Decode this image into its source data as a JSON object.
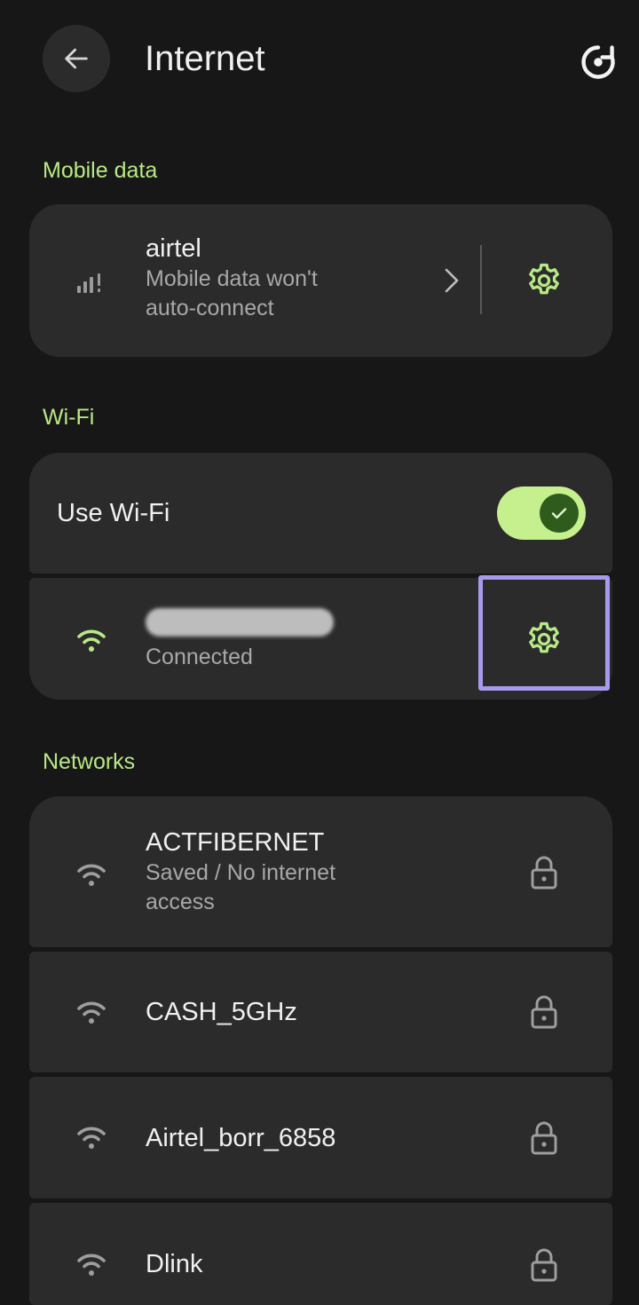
{
  "header": {
    "title": "Internet",
    "back_icon": "arrow-back-icon",
    "reset_icon": "network-reset-icon"
  },
  "mobile_data": {
    "section_label": "Mobile data",
    "carrier": "airtel",
    "status_line1": "Mobile data won't",
    "status_line2": "auto-connect",
    "signal_icon": "signal-icon"
  },
  "wifi": {
    "section_label": "Wi-Fi",
    "use_wifi_label": "Use Wi-Fi",
    "use_wifi_enabled": true,
    "connected_status": "Connected"
  },
  "networks": {
    "section_label": "Networks",
    "items": [
      {
        "name": "ACTFIBERNET",
        "status_line1": "Saved / No internet",
        "status_line2": "access"
      },
      {
        "name": "CASH_5GHz"
      },
      {
        "name": "Airtel_borr_6858"
      },
      {
        "name": "Dlink"
      }
    ]
  },
  "colors": {
    "background": "#171717",
    "card": "#2b2b2b",
    "accent_green": "#b8e986",
    "toggle_track": "#c6f08e",
    "toggle_knob": "#2f5c1c",
    "highlight": "#a899ec"
  }
}
